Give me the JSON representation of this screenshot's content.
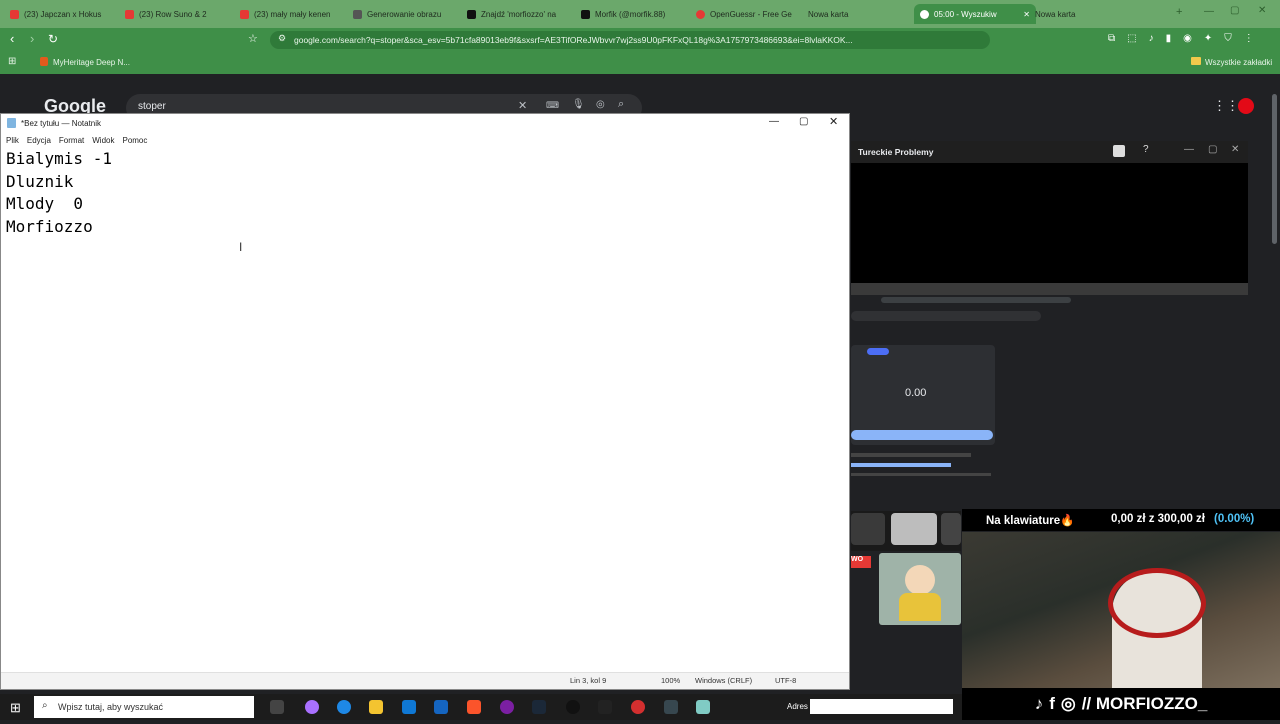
{
  "browser": {
    "tabs": [
      {
        "label": "(23) Japczan x Hokus",
        "color": "#e53935"
      },
      {
        "label": "(23) Row Suno & 2",
        "color": "#e53935"
      },
      {
        "label": "(23) mały mały kenen",
        "color": "#e53935"
      },
      {
        "label": "Generowanie obrazu",
        "color": "#555555"
      },
      {
        "label": "Znajdź 'morfiozzo' na",
        "color": "#111111"
      },
      {
        "label": "Morfik (@morfik.88)",
        "color": "#111111"
      },
      {
        "label": "OpenGuessr - Free Ge",
        "color": "#e53935"
      },
      {
        "label": "Nowa karta",
        "color": "#8bc34a"
      },
      {
        "label": "05:00 - Wyszukiw",
        "color": "#4285f4"
      },
      {
        "label": "Nowa karta",
        "color": "#8bc34a"
      }
    ],
    "url": "google.com/search?q=stoper&sca_esv=5b71cfa89013eb9f&sxsrf=AE3TifOReJWbvvr7wj2ss9U0pFKFxQL18g%3A1757973486693&ei=8lvlaKKOK...",
    "bookmark": "MyHeritage Deep N...",
    "all_bookmarks": "Wszystkie zakładki",
    "accent": "#3f8f48"
  },
  "google": {
    "logo": "Google",
    "query": "stoper"
  },
  "notepad": {
    "title": "*Bez tytułu — Notatnik",
    "menu": [
      "Plik",
      "Edycja",
      "Format",
      "Widok",
      "Pomoc"
    ],
    "lines": [
      "Bialymis -1",
      "Dluznik",
      "Mlody  0",
      "Morfiozzo"
    ],
    "status": {
      "position": "Lin 3, kol 9",
      "zoom": "100%",
      "eol": "Windows (CRLF)",
      "encoding": "UTF-8"
    }
  },
  "popout": {
    "title": "Tureckie Problemy",
    "timer": "0.00"
  },
  "stream": {
    "banner_title": "Na klawiature🔥",
    "donation": "0,00 zł z 300,00 zł",
    "percent": "(0.00%)",
    "handle": "// MORFIOZZO_"
  },
  "taskbar": {
    "search_placeholder": "Wpisz tutaj, aby wyszukać",
    "address_label": "Adres"
  }
}
